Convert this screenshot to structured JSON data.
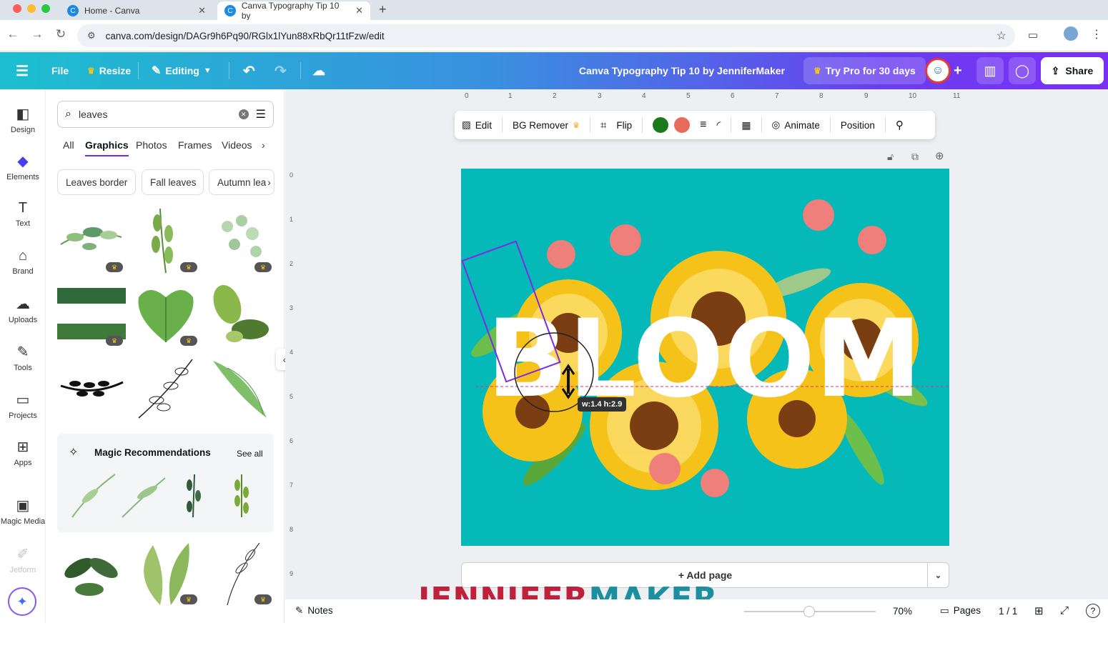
{
  "browser": {
    "tabs": [
      {
        "title": "Home - Canva"
      },
      {
        "title": "Canva Typography Tip 10 by"
      }
    ],
    "url": "canva.com/design/DAGr9h6Pq90/RGlx1lYun88xRbQr11tFzw/edit"
  },
  "header": {
    "file_label": "File",
    "resize_label": "Resize",
    "editing_label": "Editing",
    "doc_title": "Canva Typography Tip 10 by JenniferMaker",
    "pro_label": "Try Pro for 30 days",
    "share_label": "Share"
  },
  "rail": {
    "items": [
      {
        "label": "Design",
        "icon": "design-icon"
      },
      {
        "label": "Elements",
        "icon": "elements-icon"
      },
      {
        "label": "Text",
        "icon": "text-icon"
      },
      {
        "label": "Brand",
        "icon": "brand-icon"
      },
      {
        "label": "Uploads",
        "icon": "uploads-icon"
      },
      {
        "label": "Tools",
        "icon": "tools-icon"
      },
      {
        "label": "Projects",
        "icon": "projects-icon"
      },
      {
        "label": "Apps",
        "icon": "apps-icon"
      },
      {
        "label": "Magic Media",
        "icon": "magic-media-icon"
      },
      {
        "label": "Jetform",
        "icon": "jetform-icon"
      }
    ]
  },
  "panel": {
    "search_value": "leaves",
    "tabs": [
      "All",
      "Graphics",
      "Photos",
      "Frames",
      "Videos"
    ],
    "active_tab": "Graphics",
    "chips": [
      "Leaves border",
      "Fall leaves",
      "Autumn lea"
    ],
    "magic_title": "Magic Recommendations",
    "see_all": "See all"
  },
  "toolbar": {
    "edit_label": "Edit",
    "bg_remover_label": "BG Remover",
    "flip_label": "Flip",
    "animate_label": "Animate",
    "position_label": "Position",
    "colors": [
      "#1a7a1a",
      "#e86a5a"
    ]
  },
  "ruler": {
    "top": [
      "0",
      "1",
      "2",
      "3",
      "4",
      "5",
      "6",
      "7",
      "8",
      "9",
      "10",
      "11"
    ],
    "side": [
      "0",
      "1",
      "2",
      "3",
      "4",
      "5",
      "6",
      "7",
      "8",
      "9"
    ]
  },
  "canvas": {
    "word": "BLOOM",
    "background": "#06b9b9",
    "size_tooltip": "w:1.4 h:2.9"
  },
  "add_page_label": "+ Add page",
  "footer": {
    "notes_label": "Notes",
    "zoom": "70%",
    "pages_label": "Pages",
    "page_count": "1 / 1"
  },
  "watermark": {
    "part1": "JENNIFER",
    "part2": "MAKER",
    "color1": "#c0203a",
    "color2": "#1b8fa0"
  }
}
